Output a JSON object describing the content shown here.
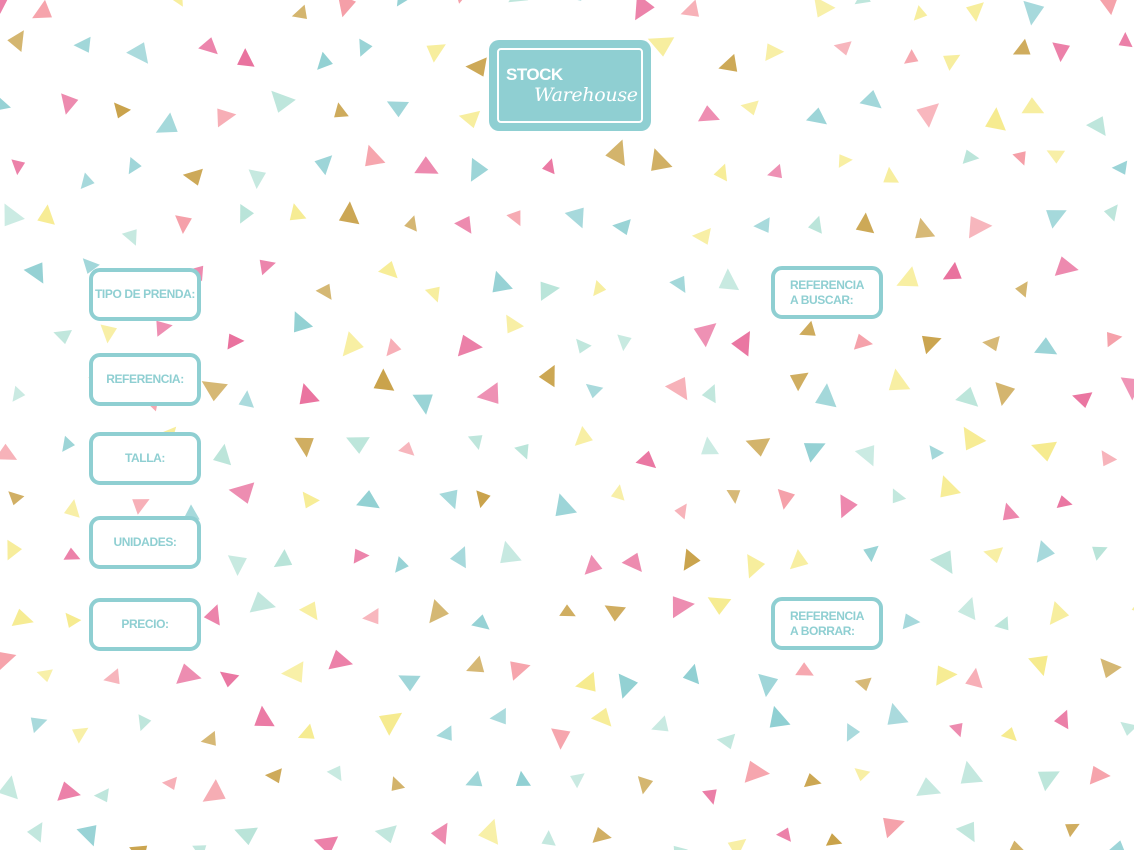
{
  "logo": {
    "line1": "STOCK",
    "line2": "Warehouse"
  },
  "form": {
    "fields": [
      {
        "label": "TIPO DE PRENDA:"
      },
      {
        "label": "REFERENCIA:"
      },
      {
        "label": "TALLA:"
      },
      {
        "label": "UNIDADES:"
      },
      {
        "label": "PRECIO:"
      }
    ]
  },
  "search": {
    "label": "REFERENCIA\nA BUSCAR:"
  },
  "delete": {
    "label": "REFERENCIA\nA BORRAR:"
  },
  "colors": {
    "accent": "#8fcfd2",
    "confetti": [
      "#8fcfd2",
      "#f59fa8",
      "#e9709d",
      "#f6eb8e",
      "#b9e4d9",
      "#c9a24a"
    ]
  }
}
